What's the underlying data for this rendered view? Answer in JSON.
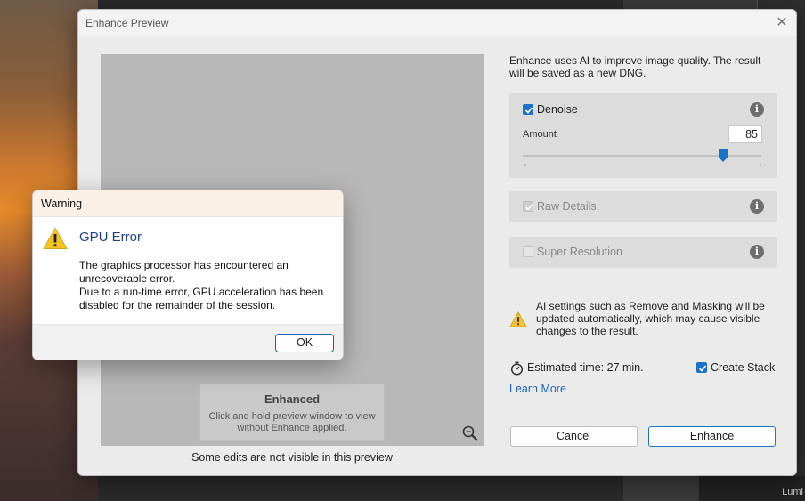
{
  "dialog": {
    "title": "Enhance Preview",
    "close_glyph": "✕"
  },
  "preview": {
    "overlay_title": "Enhanced",
    "overlay_subtitle": "Click and hold preview window to view without Enhance applied.",
    "caption": "Some edits are not visible in this preview",
    "zoom_icon": "zoom-icon"
  },
  "panel": {
    "intro": "Enhance uses AI to improve image quality. The result will be saved as a new DNG.",
    "denoise": {
      "label": "Denoise",
      "checked": true,
      "amount_label": "Amount",
      "amount": "85",
      "amount_fraction": 0.85
    },
    "raw_details": {
      "label": "Raw Details",
      "checked": true,
      "disabled": true
    },
    "super_resolution": {
      "label": "Super Resolution",
      "checked": false,
      "disabled": true
    },
    "info_glyph": "i",
    "ai_warning": "AI settings such as Remove and Masking will be updated automatically, which may cause visible changes to the result.",
    "estimate": "Estimated time: 27 min.",
    "create_stack": {
      "label": "Create Stack",
      "checked": true
    },
    "learn_more": "Learn More"
  },
  "buttons": {
    "cancel": "Cancel",
    "enhance": "Enhance"
  },
  "warning": {
    "title": "Warning",
    "heading": "GPU Error",
    "message_line1": "The graphics processor has encountered an unrecoverable error.",
    "message_line2": "Due to a run-time error, GPU acceleration has been disabled for the remainder of the session.",
    "ok": "OK"
  },
  "background": {
    "bottom_right_text": "Lumi"
  },
  "colors": {
    "accent": "#1a73c9",
    "warning_heading": "#1f3f8c",
    "link": "#1a66b8"
  }
}
